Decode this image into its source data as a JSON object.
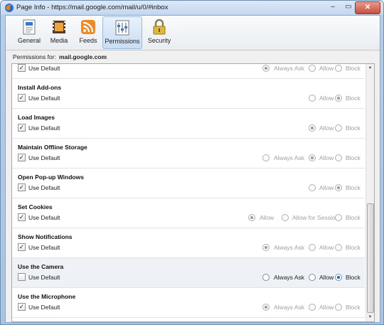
{
  "window": {
    "title": "Page Info - https://mail.google.com/mail/u/0/#inbox",
    "min_glyph": "–",
    "max_glyph": "▭",
    "close_glyph": "✕"
  },
  "tabs": [
    {
      "label": "General",
      "icon": "general-info-icon"
    },
    {
      "label": "Media",
      "icon": "media-film-icon"
    },
    {
      "label": "Feeds",
      "icon": "rss-feed-icon"
    },
    {
      "label": "Permissions",
      "icon": "permissions-icon",
      "selected": true
    },
    {
      "label": "Security",
      "icon": "padlock-icon"
    }
  ],
  "permissions_for": {
    "label": "Permissions for:",
    "host": "mail.google.com"
  },
  "options": {
    "always_ask": "Always Ask",
    "allow": "Allow",
    "block": "Block",
    "allow_session": "Allow for Session",
    "use_default": "Use Default"
  },
  "rows": [
    {
      "title": "",
      "use_default": true,
      "choices": [
        "Always Ask",
        "Allow",
        "Block"
      ],
      "selected": 0
    },
    {
      "title": "Install Add-ons",
      "use_default": true,
      "choices": [
        "Allow",
        "Block"
      ],
      "selected": 1
    },
    {
      "title": "Load Images",
      "use_default": true,
      "choices": [
        "Allow",
        "Block"
      ],
      "selected": 0
    },
    {
      "title": "Maintain Offline Storage",
      "use_default": true,
      "choices": [
        "Always Ask",
        "Allow",
        "Block"
      ],
      "selected": 1
    },
    {
      "title": "Open Pop-up Windows",
      "use_default": true,
      "choices": [
        "Allow",
        "Block"
      ],
      "selected": 1
    },
    {
      "title": "Set Cookies",
      "use_default": true,
      "choices": [
        "Allow",
        "Allow for Session",
        "Block"
      ],
      "selected": 0
    },
    {
      "title": "Show Notifications",
      "use_default": true,
      "choices": [
        "Always Ask",
        "Allow",
        "Block"
      ],
      "selected": 0
    },
    {
      "title": "Use the Camera",
      "use_default": false,
      "choices": [
        "Always Ask",
        "Allow",
        "Block"
      ],
      "selected": 2,
      "highlight": true
    },
    {
      "title": "Use the Microphone",
      "use_default": true,
      "choices": [
        "Always Ask",
        "Allow",
        "Block"
      ],
      "selected": 0
    }
  ],
  "colors": {
    "accent": "#1d5cae",
    "selected_tab": "#c9ddf3",
    "disabled_text": "#a0a0a0"
  }
}
